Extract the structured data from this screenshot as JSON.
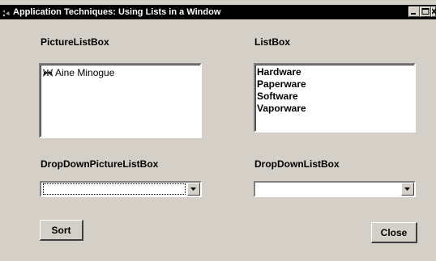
{
  "window": {
    "title": "Application Techniques: Using Lists in a Window",
    "colors": {
      "face": "#d4d0c8",
      "titlebar": "#000000",
      "title_text": "#ffffff"
    },
    "controls": {
      "minimize_icon": "minimize-icon",
      "maximize_icon": "maximize-icon",
      "close_icon": "close-icon"
    }
  },
  "picture_listbox": {
    "label": "PictureListBox",
    "items": [
      {
        "icon": "butterfly-icon",
        "text": "Aine Minogue"
      }
    ]
  },
  "listbox": {
    "label": "ListBox",
    "items": [
      "Hardware",
      "Paperware",
      "Software",
      "Vaporware"
    ]
  },
  "dropdown_picture_listbox": {
    "label": "DropDownPictureListBox",
    "value": ""
  },
  "dropdown_listbox": {
    "label": "DropDownListBox",
    "value": ""
  },
  "buttons": {
    "sort": "Sort",
    "close": "Close"
  }
}
